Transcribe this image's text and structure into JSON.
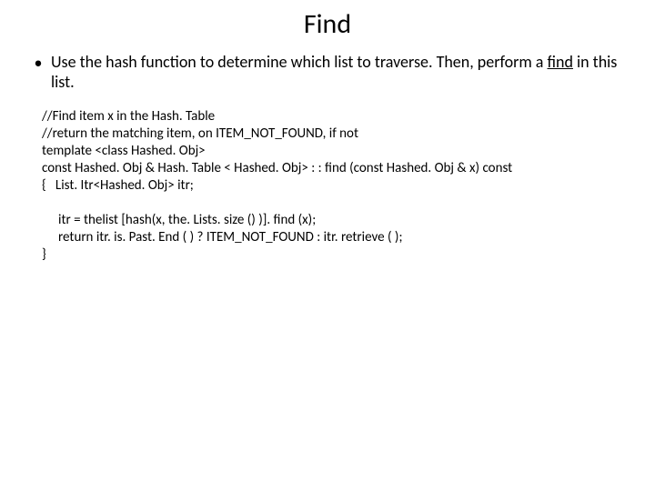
{
  "title": "Find",
  "bullet": {
    "pre": "Use the hash function to determine which list to traverse. Then, perform a ",
    "underlined": "find",
    "post": " in this list."
  },
  "code": {
    "l1": "//Find item x in the Hash. Table",
    "l2": "//return the matching item, on ITEM_NOT_FOUND, if not",
    "l3": "template <class Hashed. Obj>",
    "l4": "const Hashed. Obj & Hash. Table < Hashed. Obj> : : find (const Hashed. Obj & x) const",
    "l5": "{   List. Itr<Hashed. Obj> itr;",
    "l6": "itr = thelist [hash(x, the. Lists. size () )]. find (x);",
    "l7": "return itr. is. Past. End ( ) ? ITEM_NOT_FOUND : itr. retrieve ( );",
    "l8": "}"
  }
}
